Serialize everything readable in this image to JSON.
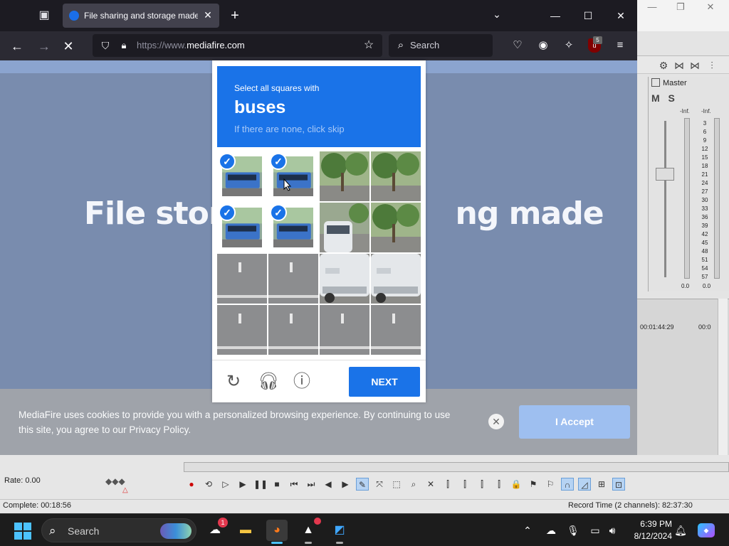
{
  "daw": {
    "master_label": "Master",
    "mixer_buttons": "M S",
    "inf_left": "-Inf.",
    "inf_right": "-Inf.",
    "meter_scale": [
      "3",
      "6",
      "9",
      "12",
      "15",
      "18",
      "21",
      "24",
      "27",
      "30",
      "33",
      "36",
      "39",
      "42",
      "45",
      "48",
      "51",
      "54",
      "57"
    ],
    "db_left": "0.0",
    "db_right": "0.0",
    "time_1": "00:01:44:29",
    "time_2": "00:0",
    "rate": "Rate: 0.00",
    "complete": "Complete: 00:18:56",
    "record_time": "Record Time (2 channels): 82:37:30"
  },
  "browser": {
    "tab_title": "File sharing and storage made",
    "url_prefix": "https://www.",
    "url_domain": "mediafire.com",
    "search_placeholder": "Search",
    "ublock_count": "5"
  },
  "page": {
    "hero_left": "File stor",
    "hero_right": "ng made",
    "cookie_text": "MediaFire uses cookies to provide you with a personalized browsing experience. By continuing to use this site, you agree to our Privacy Policy.",
    "accept_label": "I Accept"
  },
  "captcha": {
    "instruction": "Select all squares with",
    "target": "buses",
    "hint": "If there are none, click skip",
    "next_label": "NEXT",
    "check_mark": "✓",
    "selected_tiles": [
      0,
      1,
      4,
      5
    ]
  },
  "taskbar": {
    "search_placeholder": "Search",
    "weather_badge": "1",
    "time": "6:39 PM",
    "date": "8/12/2024"
  },
  "colors": {
    "captcha_blue": "#1a73e8",
    "page_overlay": "#798cae",
    "accept_button": "#9ebff0"
  }
}
